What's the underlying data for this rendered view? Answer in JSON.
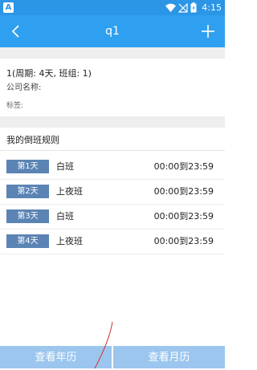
{
  "status_bar": {
    "time": "4:15",
    "app_icon": "A",
    "icons": [
      "wifi-icon",
      "signal-off-icon",
      "battery-icon"
    ]
  },
  "app_bar": {
    "title": "q1",
    "back_icon": "back-chevron-icon",
    "add_icon": "plus-icon"
  },
  "info": {
    "summary": "1(周期: 4天, 班组: 1)",
    "company_label": "公司名称:",
    "tags_label": "标签:"
  },
  "rules": {
    "title": "我的倒班规则",
    "items": [
      {
        "day": "第1天",
        "shift": "白班",
        "time": "00:00到23:59"
      },
      {
        "day": "第2天",
        "shift": "上夜班",
        "time": "00:00到23:59"
      },
      {
        "day": "第3天",
        "shift": "白班",
        "time": "00:00到23:59"
      },
      {
        "day": "第4天",
        "shift": "上夜班",
        "time": "00:00到23:59"
      }
    ]
  },
  "bottom": {
    "year_label": "查看年历",
    "month_label": "查看月历"
  },
  "colors": {
    "app_bar": "#2fa0ef",
    "status_bar": "#2b95e6",
    "day_badge": "#5b84b4",
    "bottom_button": "#9cc6ee"
  }
}
